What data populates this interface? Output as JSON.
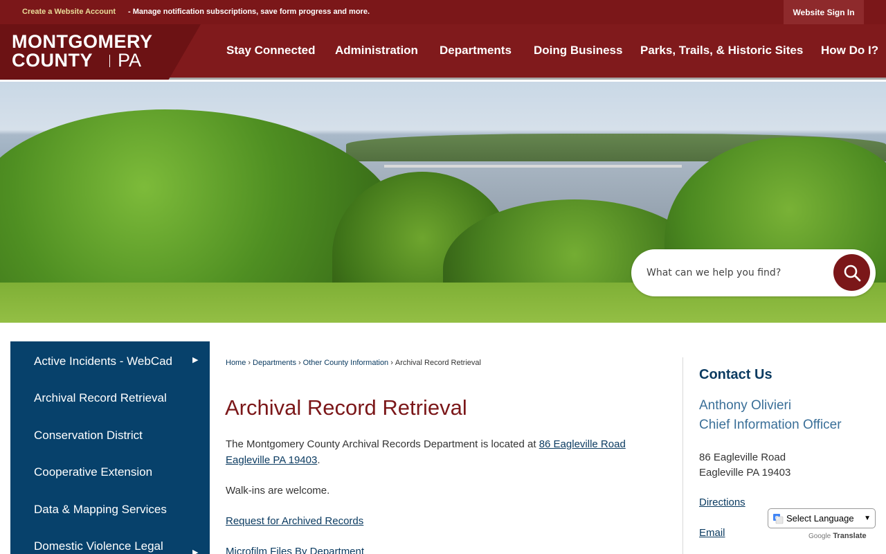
{
  "utility": {
    "create_account": "Create a Website Account",
    "create_desc": "- Manage notification subscriptions, save form progress and more.",
    "sign_in": "Website Sign In"
  },
  "logo": {
    "line1": "MONTGOMERY",
    "line2": "COUNTY",
    "suffix": "PA"
  },
  "nav": [
    "Stay Connected",
    "Administration",
    "Departments",
    "Doing Business",
    "Parks, Trails, & Historic Sites",
    "How Do I?"
  ],
  "search": {
    "placeholder": "What can we help you find?"
  },
  "sidebar": {
    "items": [
      {
        "label": "Active Incidents - WebCad",
        "has_arrow": true
      },
      {
        "label": "Archival Record Retrieval",
        "has_arrow": false
      },
      {
        "label": "Conservation District",
        "has_arrow": false
      },
      {
        "label": "Cooperative Extension",
        "has_arrow": false
      },
      {
        "label": "Data & Mapping Services",
        "has_arrow": false
      },
      {
        "label": "Domestic Violence Legal",
        "has_arrow": true
      }
    ]
  },
  "breadcrumb": {
    "home": "Home",
    "departments": "Departments",
    "other": "Other County Information",
    "current": "Archival Record Retrieval",
    "separator": "›"
  },
  "main": {
    "title": "Archival Record Retrieval",
    "intro": "The Montgomery County Archival Records Department is located at ",
    "address_link": "86 Eagleville Road Eagleville PA 19403",
    "intro_end": ".",
    "walkins": "Walk-ins are welcome.",
    "request_link": "Request for Archived Records",
    "microfilm_link": "Microfilm Files By Department"
  },
  "contact": {
    "title": "Contact Us",
    "name": "Anthony Olivieri",
    "role": "Chief Information Officer",
    "addr1": "86 Eagleville Road",
    "addr2": "Eagleville PA 19403",
    "directions": "Directions",
    "email": "Email"
  },
  "translate": {
    "select_label": "Select Language",
    "powered_by": "Google",
    "translate": "Translate"
  },
  "colors": {
    "brand_red": "#7b1719",
    "navy": "#07416b",
    "link_blue": "#0b3b61"
  }
}
